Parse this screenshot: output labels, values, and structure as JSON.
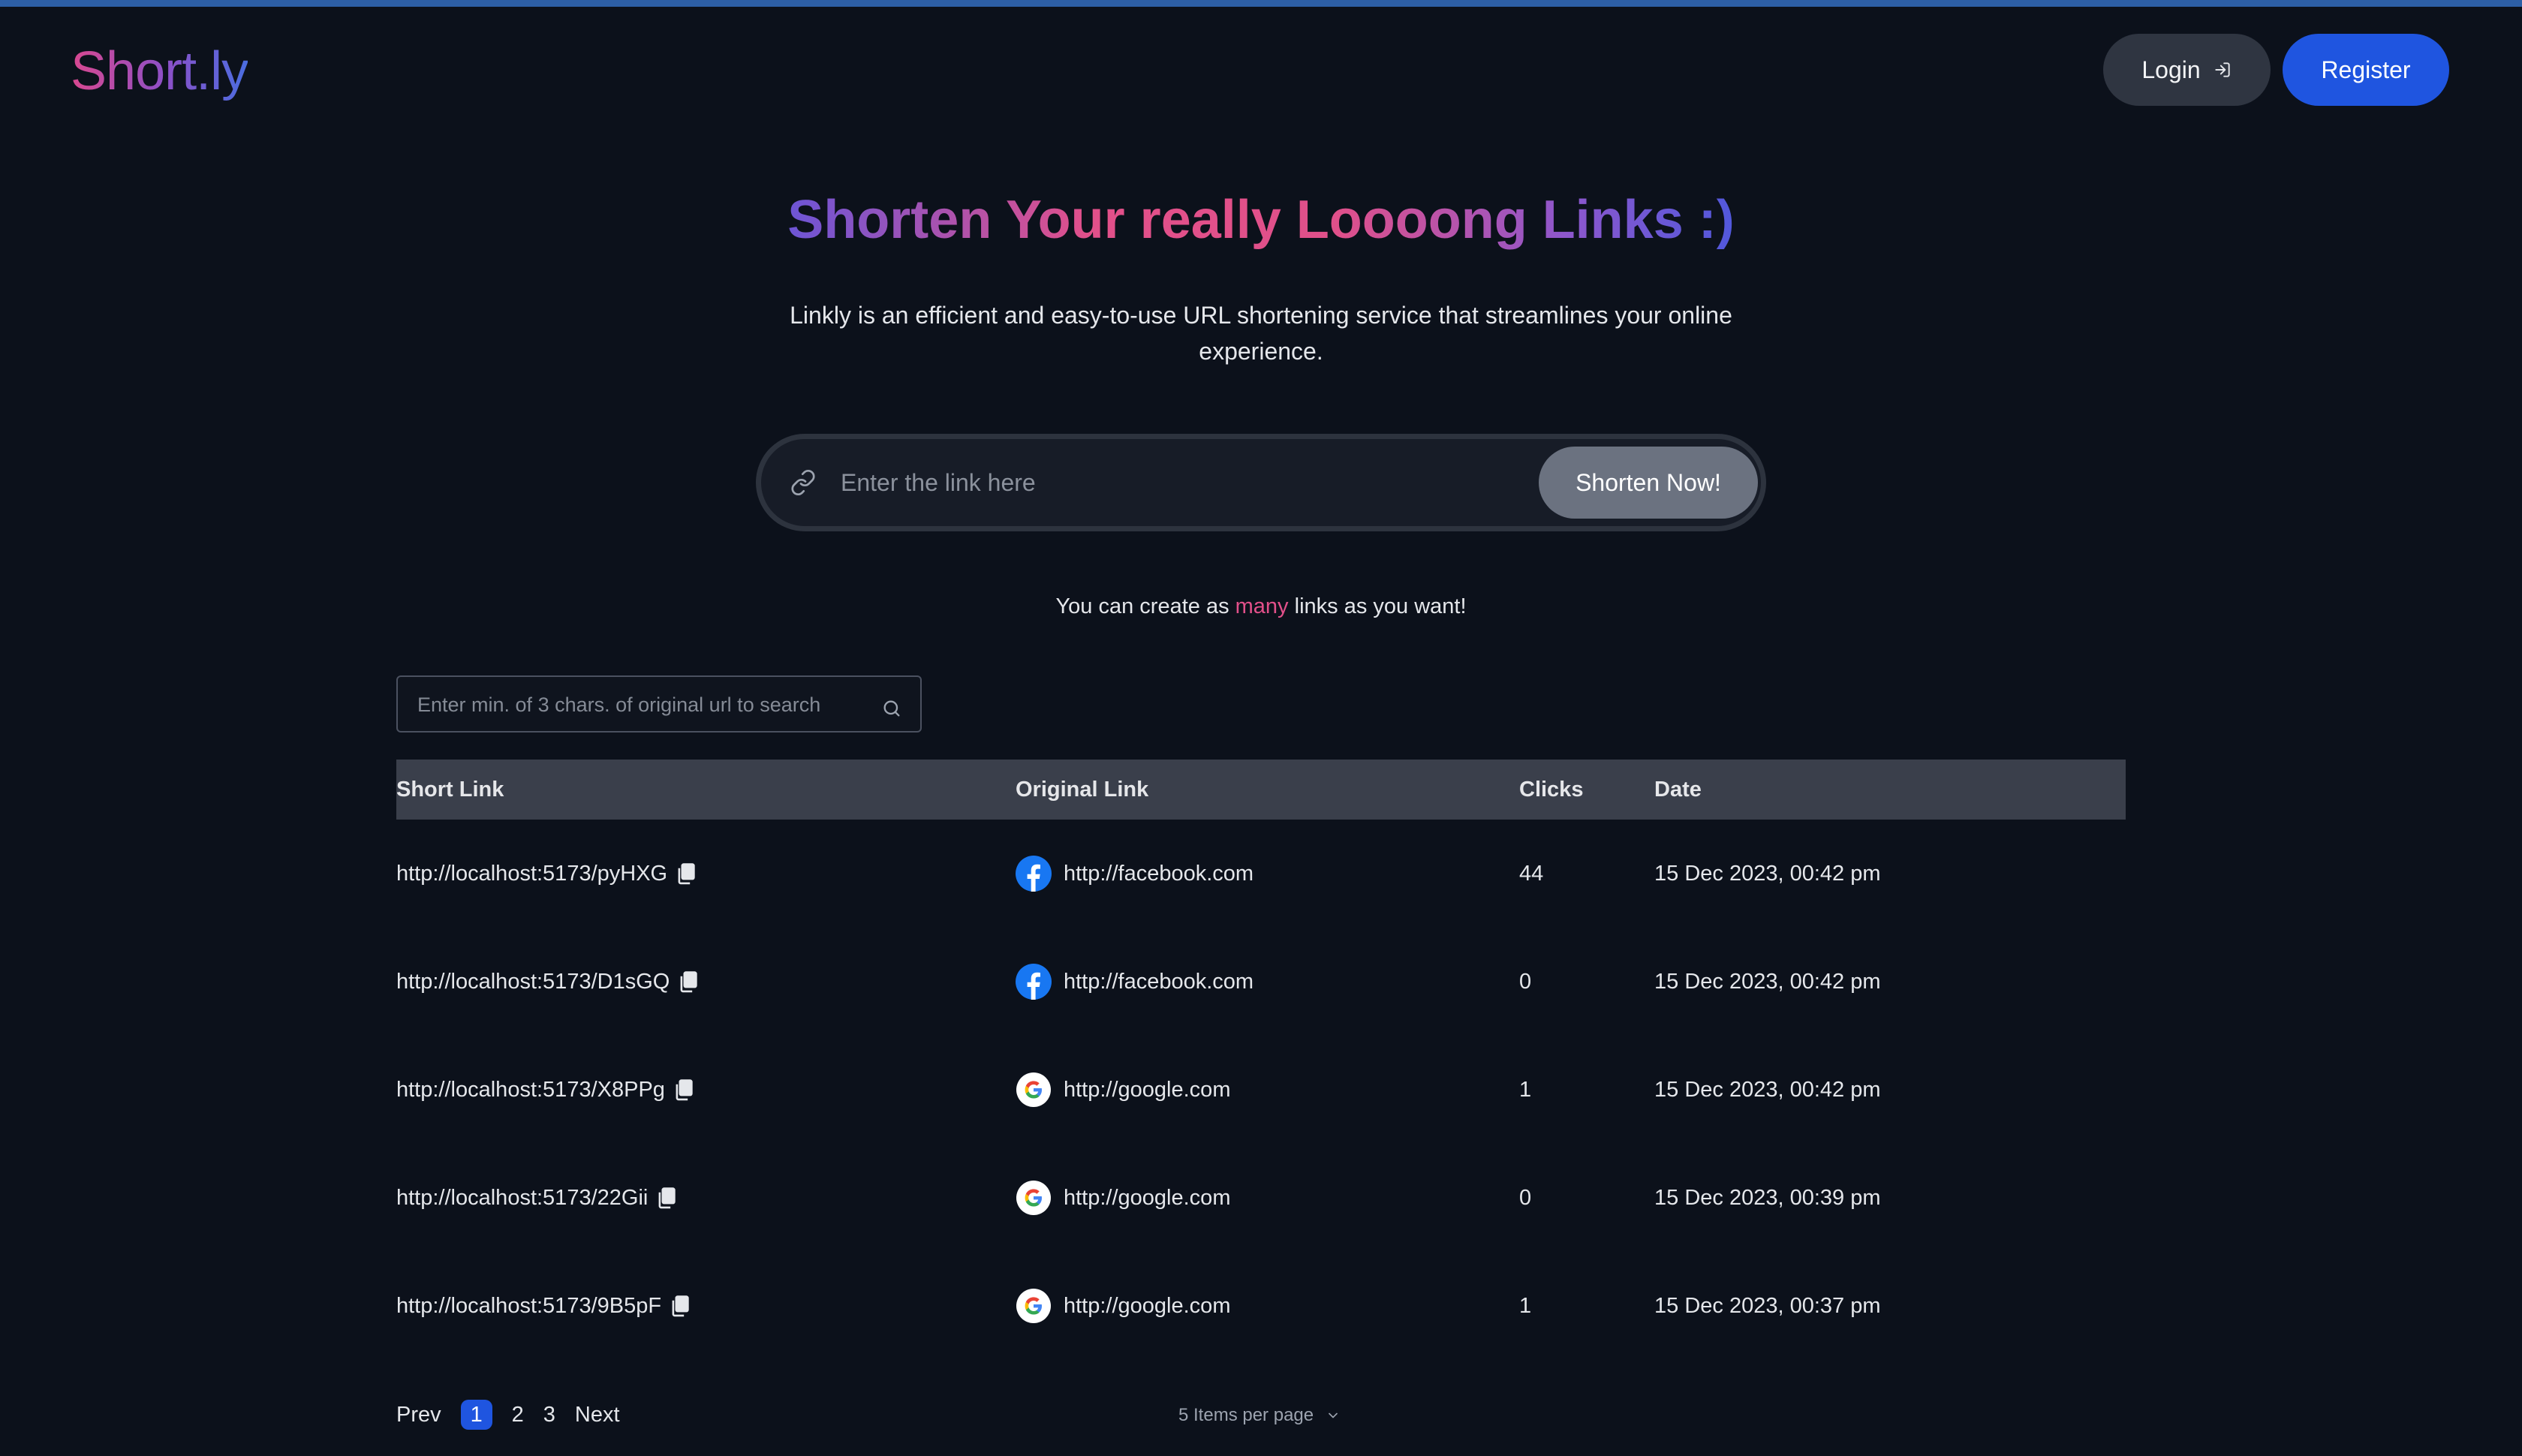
{
  "header": {
    "logo": "Short.ly",
    "login_label": "Login",
    "register_label": "Register"
  },
  "hero": {
    "title": "Shorten Your really Loooong Links :)",
    "description": "Linkly is an efficient and easy-to-use URL shortening service that streamlines your online experience."
  },
  "shorten": {
    "placeholder": "Enter the link here",
    "value": "",
    "button_label": "Shorten Now!"
  },
  "note": {
    "before": "You can create as",
    "accent": "many",
    "after": "links as you want!"
  },
  "search": {
    "placeholder": "Enter min. of 3 chars. of original url to search",
    "value": ""
  },
  "table": {
    "headers": [
      "Short Link",
      "Original Link",
      "Clicks",
      "Date"
    ],
    "rows": [
      {
        "short": "http://localhost:5173/pyHXG",
        "original": "http://facebook.com",
        "icon": "facebook-icon",
        "clicks": "44",
        "date": "15 Dec 2023, 00:42 pm"
      },
      {
        "short": "http://localhost:5173/D1sGQ",
        "original": "http://facebook.com",
        "icon": "facebook-icon",
        "clicks": "0",
        "date": "15 Dec 2023, 00:42 pm"
      },
      {
        "short": "http://localhost:5173/X8PPg",
        "original": "http://google.com",
        "icon": "google-icon",
        "clicks": "1",
        "date": "15 Dec 2023, 00:42 pm"
      },
      {
        "short": "http://localhost:5173/22Gii",
        "original": "http://google.com",
        "icon": "google-icon",
        "clicks": "0",
        "date": "15 Dec 2023, 00:39 pm"
      },
      {
        "short": "http://localhost:5173/9B5pF",
        "original": "http://google.com",
        "icon": "google-icon",
        "clicks": "1",
        "date": "15 Dec 2023, 00:37 pm"
      }
    ]
  },
  "pagination": {
    "prev_label": "Prev",
    "pages": [
      "1",
      "2",
      "3"
    ],
    "current_page": "1",
    "next_label": "Next",
    "per_page_label": "5 Items per page"
  },
  "colors": {
    "background": "#0c111b",
    "accent_blue": "#1f55e0",
    "accent_pink": "#e2508a",
    "header_row": "#3a3f4b",
    "shorten_button": "#6b7280",
    "facebook_blue": "#1877f2"
  }
}
